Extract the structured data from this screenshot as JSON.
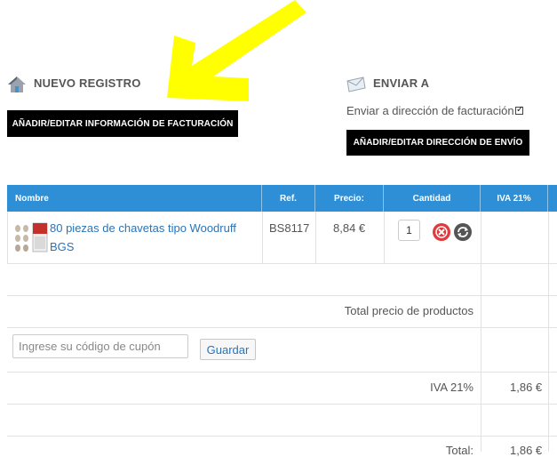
{
  "registro": {
    "title": "NUEVO REGISTRO",
    "billing_button": "AÑADIR/EDITAR INFORMACIÓN DE FACTURACIÓN"
  },
  "enviar": {
    "title": "ENVIAR A",
    "same_address_label": "Enviar a dirección de facturación",
    "same_address_checked": true,
    "shipping_button": "AÑADIR/EDITAR DIRECCIÓN DE ENVÍO"
  },
  "table": {
    "headers": {
      "nombre": "Nombre",
      "ref": "Ref.",
      "precio": "Precio:",
      "cantidad": "Cantidad",
      "iva": "IVA 21%"
    },
    "rows": [
      {
        "name": "80 piezas de chavetas tipo Woodruff BGS",
        "ref": "BS8117",
        "price": "8,84 €",
        "qty": "1",
        "iva": ""
      }
    ],
    "total_products_label": "Total precio de productos",
    "iva_label": "IVA 21%",
    "iva_value": "1,86 €",
    "total_label": "Total:",
    "total_value": "1,86 €"
  },
  "coupon": {
    "placeholder": "Ingrese su código de cupón",
    "save_label": "Guardar"
  },
  "colors": {
    "header_blue": "#2f8fd6",
    "link_blue": "#2a74b8",
    "arrow_yellow": "#ffff00",
    "button_black": "#000000"
  }
}
